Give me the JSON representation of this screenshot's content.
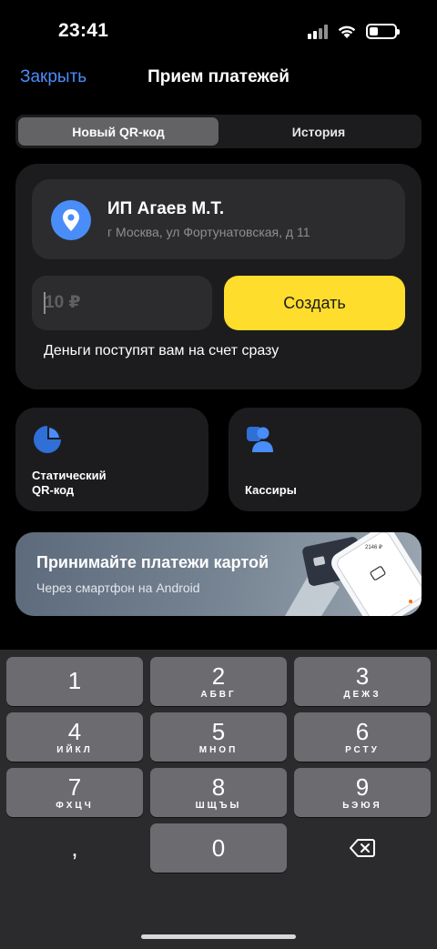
{
  "status_bar": {
    "time": "23:41",
    "icons": [
      "cellular-signal-icon",
      "wifi-icon",
      "battery-icon"
    ]
  },
  "nav": {
    "close_label": "Закрыть",
    "title": "Прием платежей"
  },
  "tabs": [
    {
      "label": "Новый QR-код",
      "active": true
    },
    {
      "label": "История",
      "active": false
    }
  ],
  "merchant": {
    "name": "ИП Агаев М.Т.",
    "address": "г Москва, ул Фортунатовская, д 11",
    "icon": "location-pin-icon"
  },
  "payment": {
    "amount_placeholder": "10 ₽",
    "amount_value": "",
    "create_label": "Создать",
    "note": "Деньги поступят вам на счет сразу"
  },
  "tiles": [
    {
      "label_line1": "Статический",
      "label_line2": "QR-код",
      "icon": "static-qr-icon"
    },
    {
      "label": "Кассиры",
      "icon": "cashiers-icon"
    }
  ],
  "banner": {
    "title": "Принимайте платежи картой",
    "subtitle": "Через смартфон на Android",
    "phone_screen_amount": "2146 ₽"
  },
  "keyboard": {
    "keys": [
      {
        "digit": "1",
        "letters": ""
      },
      {
        "digit": "2",
        "letters": "АБВГ"
      },
      {
        "digit": "3",
        "letters": "ДЕЖЗ"
      },
      {
        "digit": "4",
        "letters": "ИЙКЛ"
      },
      {
        "digit": "5",
        "letters": "МНОП"
      },
      {
        "digit": "6",
        "letters": "РСТУ"
      },
      {
        "digit": "7",
        "letters": "ФХЦЧ"
      },
      {
        "digit": "8",
        "letters": "ШЩЪЫ"
      },
      {
        "digit": "9",
        "letters": "ЬЭЮЯ"
      }
    ],
    "comma": ",",
    "zero": "0",
    "delete_icon": "backspace-icon"
  },
  "colors": {
    "accent_blue": "#4a8df8",
    "button_yellow": "#fedd2c",
    "card_bg": "#1c1c1e"
  }
}
